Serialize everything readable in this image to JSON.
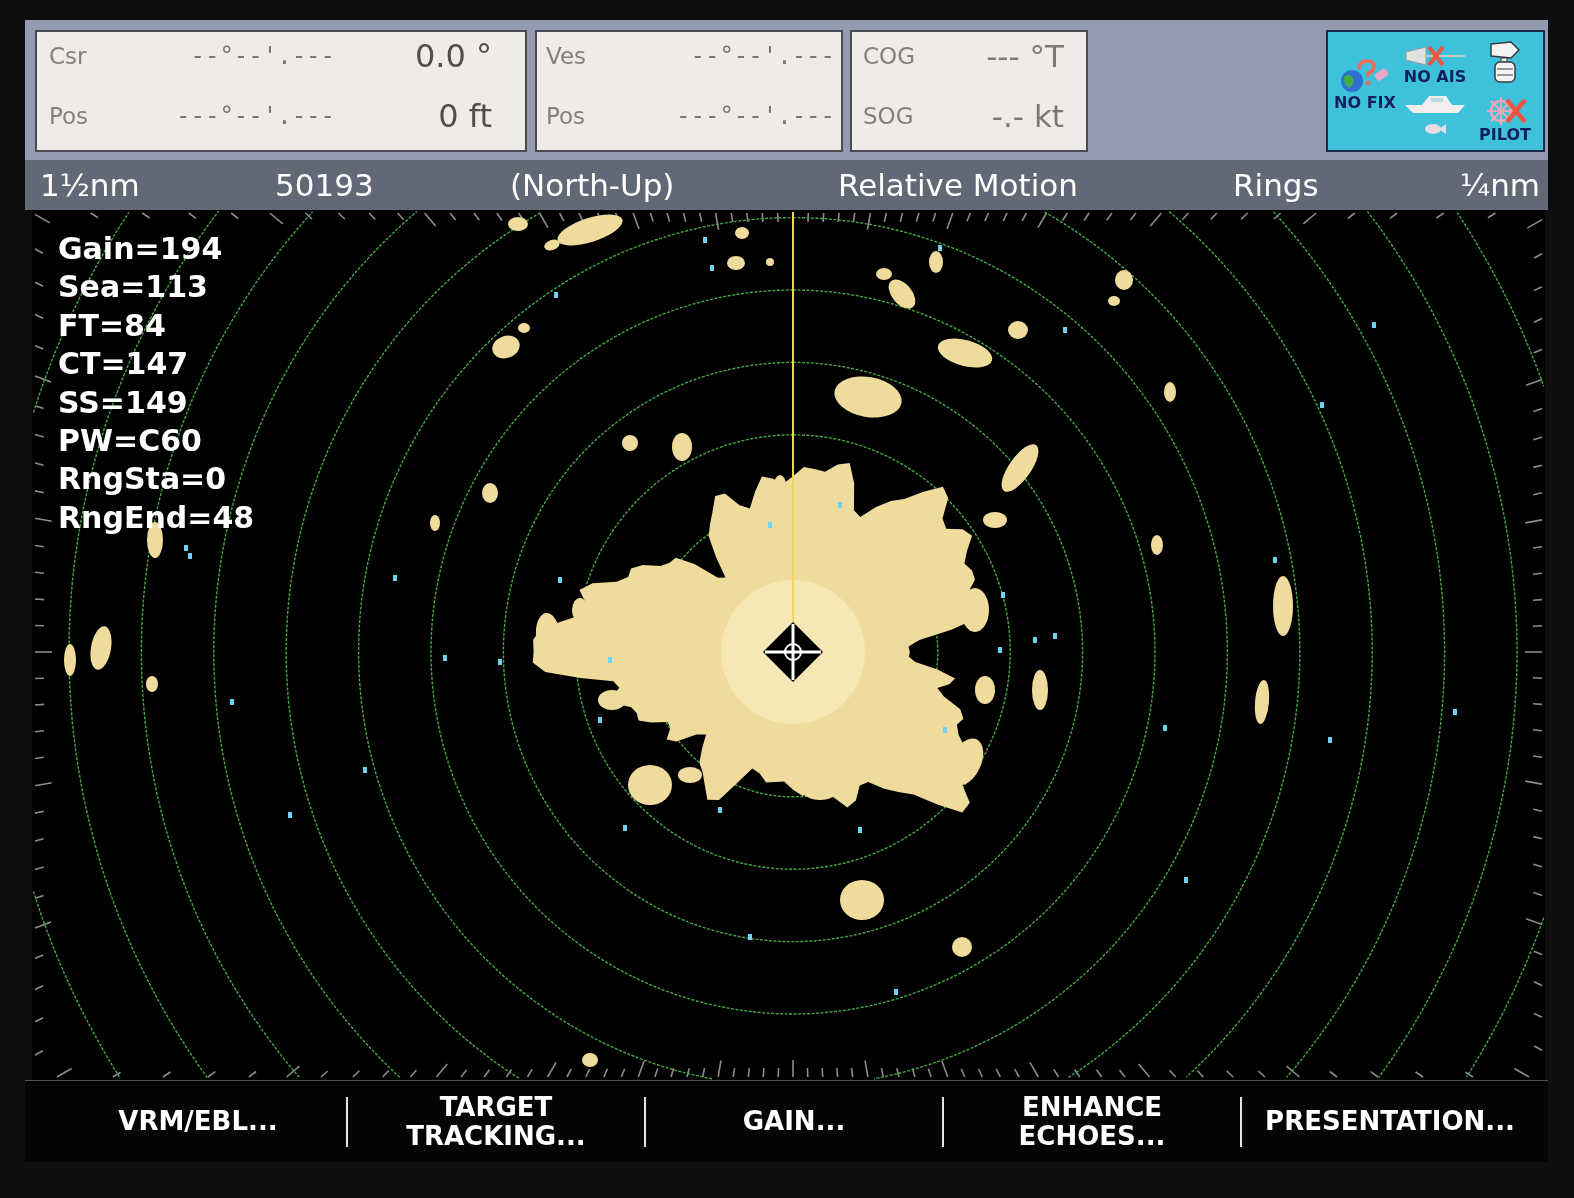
{
  "info_panels": [
    {
      "rows": [
        {
          "label": "Csr",
          "position": "--°--'.---",
          "value": "0.0 °"
        },
        {
          "label": "Pos",
          "position": "---°--'.---",
          "value": "0 ft"
        }
      ]
    },
    {
      "rows": [
        {
          "label": "Ves",
          "position": "--°--'.---"
        },
        {
          "label": "Pos",
          "position": "---°--'.---"
        }
      ]
    },
    {
      "rows": [
        {
          "label": "COG",
          "value": "--- °T"
        },
        {
          "label": "SOG",
          "value": "-.- kt"
        }
      ]
    }
  ],
  "status_icons": [
    {
      "kind": "gps",
      "label": "NO FIX"
    },
    {
      "kind": "ais",
      "label": "NO AIS"
    },
    {
      "kind": "boat"
    },
    {
      "kind": "fish"
    },
    {
      "kind": "radar"
    },
    {
      "kind": "pilot",
      "label": "PILOT"
    }
  ],
  "status_bar": [
    "1½nm",
    "50193",
    "(North-Up)",
    "Relative Motion",
    "Rings",
    "¼nm"
  ],
  "radar_settings": [
    "Gain=194",
    "Sea=113",
    "FT=84",
    "CT=147",
    "SS=149",
    "PW=C60",
    "RngSta=0",
    "RngEnd=48"
  ],
  "soft_keys": [
    "VRM/EBL...",
    "TARGET TRACKING...",
    "GAIN...",
    "ENHANCE ECHOES...",
    "PRESENTATION..."
  ]
}
